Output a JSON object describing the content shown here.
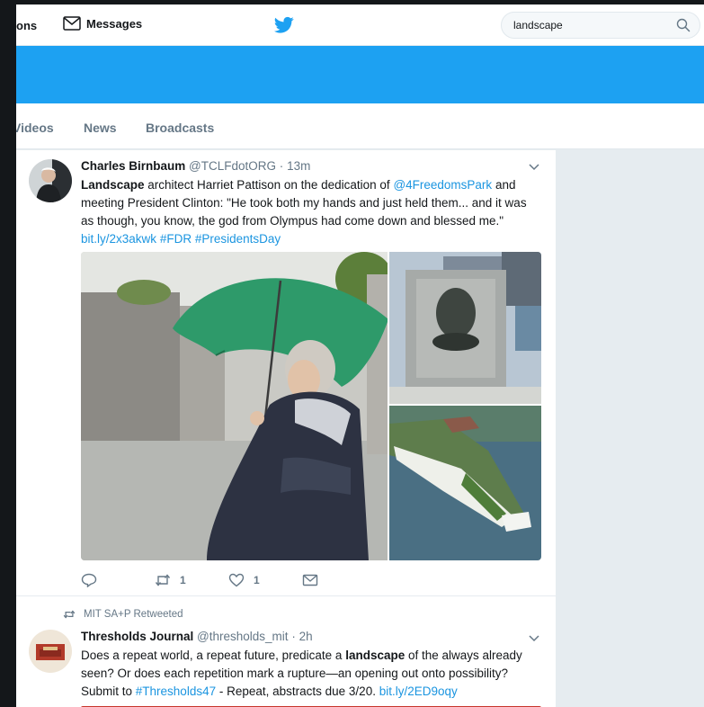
{
  "nav": {
    "partial_label": "ons",
    "messages_label": "Messages",
    "search_value": "landscape"
  },
  "tabs": [
    {
      "label": "Videos"
    },
    {
      "label": "News"
    },
    {
      "label": "Broadcasts"
    }
  ],
  "tweets": [
    {
      "name": "Charles Birnbaum",
      "handle": "@TCLFdotORG",
      "dot": "·",
      "time": "13m",
      "text": {
        "keyword": "Landscape",
        "part1": " architect Harriet Pattison on the dedication of ",
        "mention": "@4FreedomsPark",
        "part2": " and meeting President Clinton: \"He took both my hands and just held them... and it was as though, you know, the god from Olympus had come down and blessed me.\" ",
        "link": "bit.ly/2x3akwk",
        "space": " ",
        "hashtag1": "#FDR",
        "hashtag2": "#PresidentsDay"
      },
      "retweets": "1",
      "likes": "1"
    },
    {
      "retweeted_by": "MIT SA+P Retweeted",
      "name": "Thresholds Journal",
      "handle": "@thresholds_mit",
      "dot": "·",
      "time": "2h",
      "text": {
        "part1": "Does a repeat world, a repeat future, predicate a ",
        "keyword": "landscape",
        "part2": " of the always already seen? Or does each repetition mark a rupture—an opening out onto possibility? Submit to ",
        "hashtag": "#Thresholds47",
        "part3": " - Repeat, abstracts due 3/20. ",
        "link": "bit.ly/2ED9oqy"
      }
    }
  ],
  "icons": {
    "brand": "twitter-bird",
    "accent": "#1da1f2",
    "link": "#1b95e0",
    "muted": "#657786"
  }
}
